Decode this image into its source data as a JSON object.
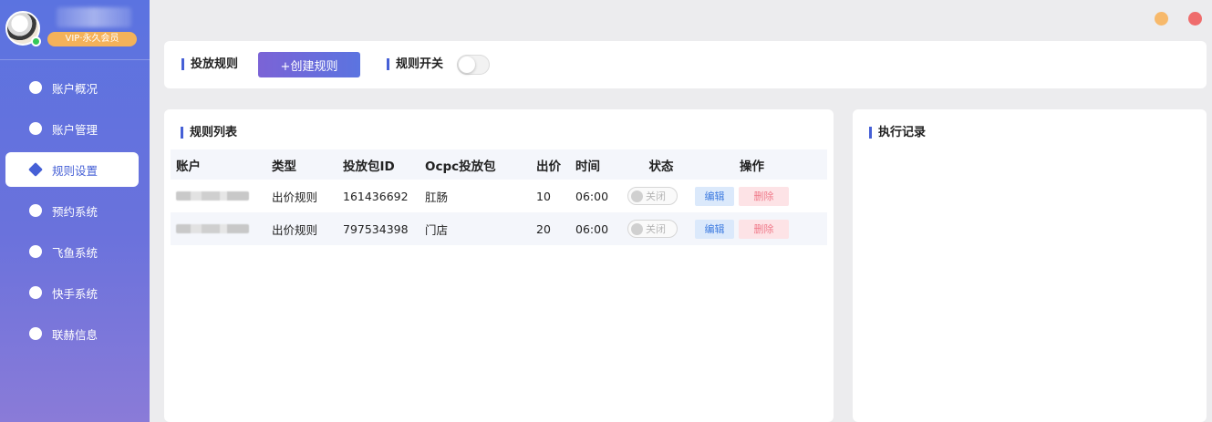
{
  "sidebar": {
    "vip_badge": "VIP·永久会员",
    "items": [
      {
        "label": "账户概况",
        "icon": "cube-icon",
        "active": false
      },
      {
        "label": "账户管理",
        "icon": "user-icon",
        "active": false
      },
      {
        "label": "规则设置",
        "icon": "layers-icon",
        "active": true
      },
      {
        "label": "预约系统",
        "icon": "shield-icon",
        "active": false
      },
      {
        "label": "飞鱼系统",
        "icon": "tiktok-icon",
        "active": false
      },
      {
        "label": "快手系统",
        "icon": "compass-icon",
        "active": false
      },
      {
        "label": "联赫信息",
        "icon": "chat-icon",
        "active": false
      }
    ]
  },
  "toolbar": {
    "section_title": "投放规则",
    "create_button": "+创建规则",
    "switch_label": "规则开关",
    "switch_on": false
  },
  "rules": {
    "title": "规则列表",
    "columns": [
      "账户",
      "类型",
      "投放包ID",
      "Ocpc投放包",
      "出价",
      "时间",
      "状态",
      "操作"
    ],
    "rows": [
      {
        "type": "出价规则",
        "package_id": "161436692",
        "ocpc": "肛肠",
        "bid": "10",
        "time": "06:00",
        "state": "关闭",
        "edit": "编辑",
        "delete": "删除"
      },
      {
        "type": "出价规则",
        "package_id": "797534398",
        "ocpc": "门店",
        "bid": "20",
        "time": "06:00",
        "state": "关闭",
        "edit": "编辑",
        "delete": "删除"
      }
    ]
  },
  "records": {
    "title": "执行记录"
  },
  "colors": {
    "accent": "#4660d6",
    "sidebar_top": "#5b73e0",
    "sidebar_bottom": "#8a7bd8",
    "vip": "#f4b25a",
    "minimize": "#f7b96b",
    "close": "#ef6c6c"
  }
}
